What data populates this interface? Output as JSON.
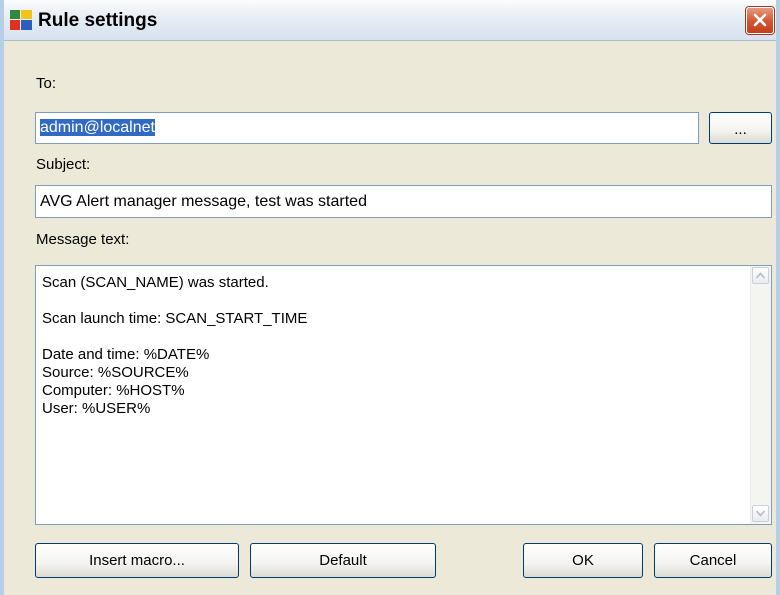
{
  "window": {
    "title": "Rule settings",
    "close_icon": "close-icon"
  },
  "to": {
    "label": "To:",
    "value": "admin@localnet",
    "browse_label": "..."
  },
  "subject": {
    "label": "Subject:",
    "value": "AVG Alert manager message, test was started"
  },
  "message": {
    "label": "Message text:",
    "lines": [
      "Scan (SCAN_NAME) was started.",
      "",
      "Scan launch time: SCAN_START_TIME",
      "",
      "Date and time: %DATE%",
      "Source: %SOURCE%",
      "Computer: %HOST%",
      "User: %USER%"
    ]
  },
  "buttons": {
    "insert_macro": "Insert macro...",
    "default": "Default",
    "ok": "OK",
    "cancel": "Cancel"
  },
  "colors": {
    "selection": "#316ac5",
    "close_button": "#d4542e",
    "dialog_bg": "#ece9d8"
  }
}
